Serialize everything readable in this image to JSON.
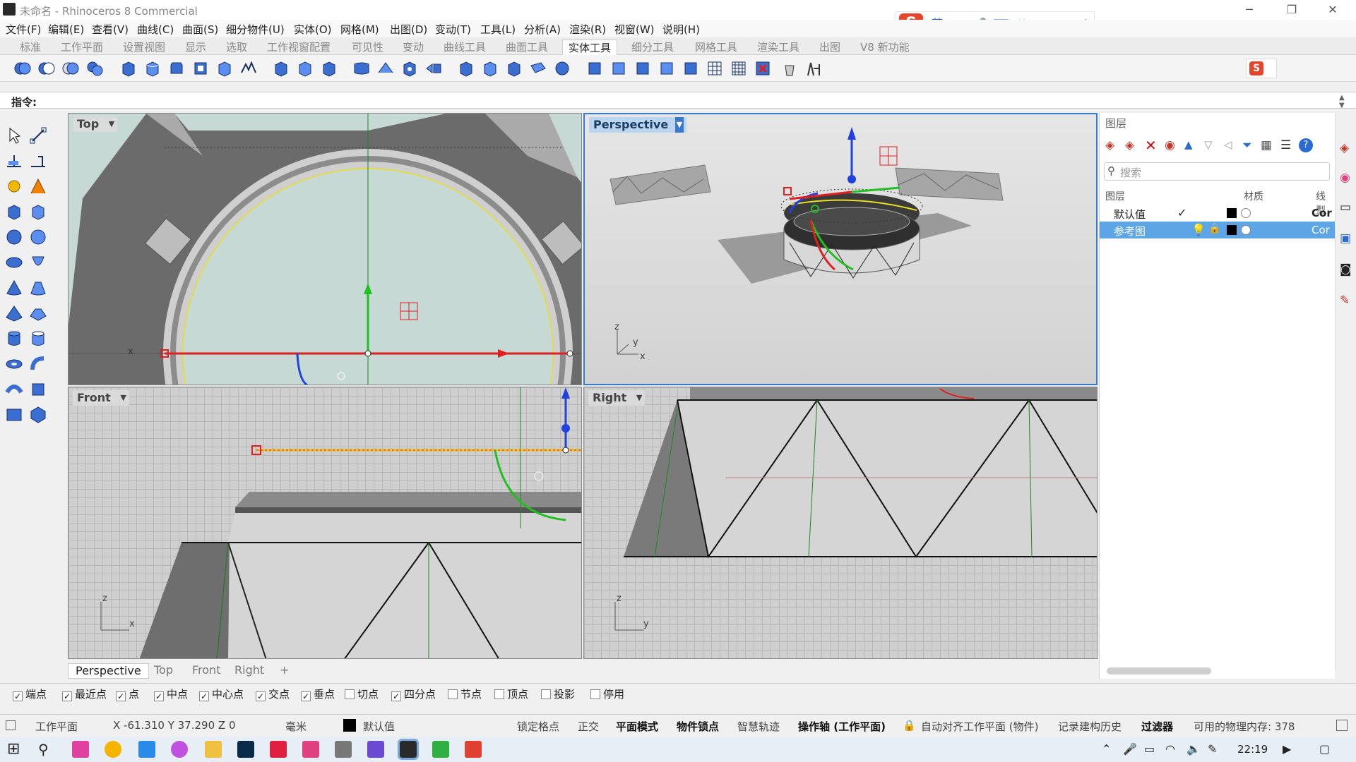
{
  "window": {
    "title": "未命名 - Rhinoceros 8 Commercial"
  },
  "menu": [
    "文件(F)",
    "编辑(E)",
    "查看(V)",
    "曲线(C)",
    "曲面(S)",
    "细分物件(U)",
    "实体(O)",
    "网格(M)",
    "出图(D)",
    "变动(T)",
    "工具(L)",
    "分析(A)",
    "渲染(R)",
    "视窗(W)",
    "说明(H)"
  ],
  "tabs": [
    "标准",
    "工作平面",
    "设置视图",
    "显示",
    "选取",
    "工作视窗配置",
    "可见性",
    "变动",
    "曲线工具",
    "曲面工具",
    "实体工具",
    "细分工具",
    "网格工具",
    "渲染工具",
    "出图",
    "V8 新功能"
  ],
  "active_tab": "实体工具",
  "ime": {
    "logo": "S",
    "lang": "英"
  },
  "command": {
    "label": "指令:"
  },
  "viewports": {
    "top": "Top",
    "perspective": "Perspective",
    "front": "Front",
    "right": "Right"
  },
  "axis_labels": {
    "persp_z": "z",
    "persp_y": "y",
    "persp_x": "x",
    "front_z": "z",
    "front_x": "x",
    "right_z": "z",
    "right_y": "y",
    "top_x": "x"
  },
  "layers": {
    "title": "图层",
    "search_placeholder": "搜索",
    "headers": {
      "layer": "图层",
      "material": "材质",
      "linetype": "线型"
    },
    "rows": [
      {
        "name": "默认值",
        "linetype": "Cor",
        "current": true
      },
      {
        "name": "参考图",
        "linetype": "Cor",
        "selected": true
      }
    ]
  },
  "viewport_tabs": [
    "Perspective",
    "Top",
    "Front",
    "Right"
  ],
  "osnaps": [
    {
      "label": "端点",
      "checked": true
    },
    {
      "label": "最近点",
      "checked": true
    },
    {
      "label": "点",
      "checked": true
    },
    {
      "label": "中点",
      "checked": true
    },
    {
      "label": "中心点",
      "checked": true
    },
    {
      "label": "交点",
      "checked": true
    },
    {
      "label": "垂点",
      "checked": true
    },
    {
      "label": "切点",
      "checked": false
    },
    {
      "label": "四分点",
      "checked": true
    },
    {
      "label": "节点",
      "checked": false
    },
    {
      "label": "顶点",
      "checked": false
    },
    {
      "label": "投影",
      "checked": false
    },
    {
      "label": "停用",
      "checked": false
    }
  ],
  "status": {
    "cplane": "工作平面",
    "coords": "X -61.310 Y 37.290 Z 0",
    "units": "毫米",
    "layer": "默认值",
    "items": [
      "锁定格点",
      "正交",
      "平面模式",
      "物件锁点",
      "智慧轨迹",
      "操作轴 (工作平面)",
      "自动对齐工作平面 (物件)",
      "记录建构历史",
      "过滤器",
      "可用的物理内存: 378"
    ]
  },
  "taskbar": {
    "time": "22:19"
  },
  "colors": {
    "accent": "#5ea5e6",
    "active_viewport": "#bcd5ee",
    "gumball_x": "#e02020",
    "gumball_y": "#20c020",
    "gumball_z": "#2040e0"
  }
}
